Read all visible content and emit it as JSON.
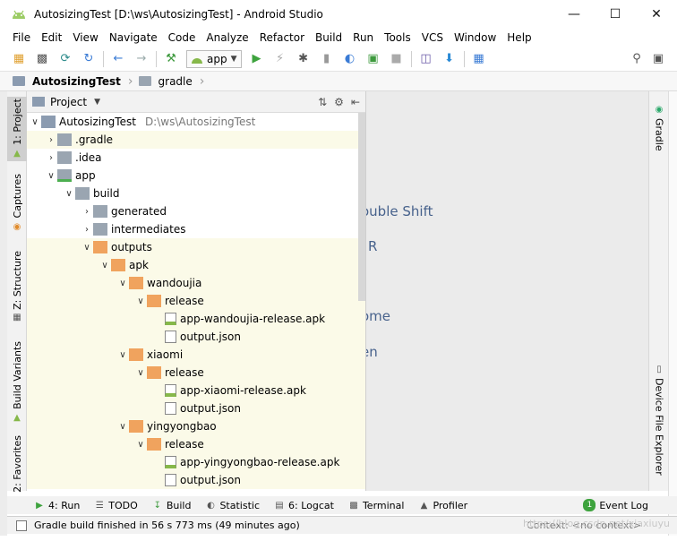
{
  "window": {
    "title": "AutosizingTest [D:\\ws\\AutosizingTest] - Android Studio",
    "controls": [
      "minimize",
      "maximize",
      "close"
    ]
  },
  "menu": [
    "File",
    "Edit",
    "View",
    "Navigate",
    "Code",
    "Analyze",
    "Refactor",
    "Build",
    "Run",
    "Tools",
    "VCS",
    "Window",
    "Help"
  ],
  "toolbar": {
    "run_config": "app"
  },
  "breadcrumb": [
    {
      "label": "AutosizingTest"
    },
    {
      "label": "gradle"
    }
  ],
  "left_tabs": [
    "1: Project",
    "Captures",
    "Z: Structure",
    "Build Variants",
    "2: Favorites"
  ],
  "right_tabs": [
    "Gradle",
    "Device File Explorer"
  ],
  "project_panel": {
    "view_label": "Project"
  },
  "tree": [
    {
      "label": "AutosizingTest",
      "path": "D:\\ws\\AutosizingTest"
    },
    {
      "label": ".gradle"
    },
    {
      "label": ".idea"
    },
    {
      "label": "app"
    },
    {
      "label": "build"
    },
    {
      "label": "generated"
    },
    {
      "label": "intermediates"
    },
    {
      "label": "outputs"
    },
    {
      "label": "apk"
    },
    {
      "label": "wandoujia"
    },
    {
      "label": "release"
    },
    {
      "label": "app-wandoujia-release.apk"
    },
    {
      "label": "output.json"
    },
    {
      "label": "xiaomi"
    },
    {
      "label": "release"
    },
    {
      "label": "app-xiaomi-release.apk"
    },
    {
      "label": "output.json"
    },
    {
      "label": "yingyongbao"
    },
    {
      "label": "release"
    },
    {
      "label": "app-yingyongbao-release.apk"
    },
    {
      "label": "output.json"
    }
  ],
  "editor_hints": [
    "ouble Shift",
    "R",
    "ome",
    "en"
  ],
  "bottom_tabs": [
    {
      "label": "4: Run"
    },
    {
      "label": "TODO"
    },
    {
      "label": "Build"
    },
    {
      "label": "Statistic"
    },
    {
      "label": "6: Logcat"
    },
    {
      "label": "Terminal"
    },
    {
      "label": "Profiler"
    },
    {
      "label": "Event Log",
      "badge": "1"
    }
  ],
  "status": {
    "message": "Gradle build finished in 56 s 773 ms (49 minutes ago)",
    "context_label": "Context:",
    "context_value": "<no context>"
  },
  "watermark": "https://blog.csdn.net/xiaxiuyu"
}
